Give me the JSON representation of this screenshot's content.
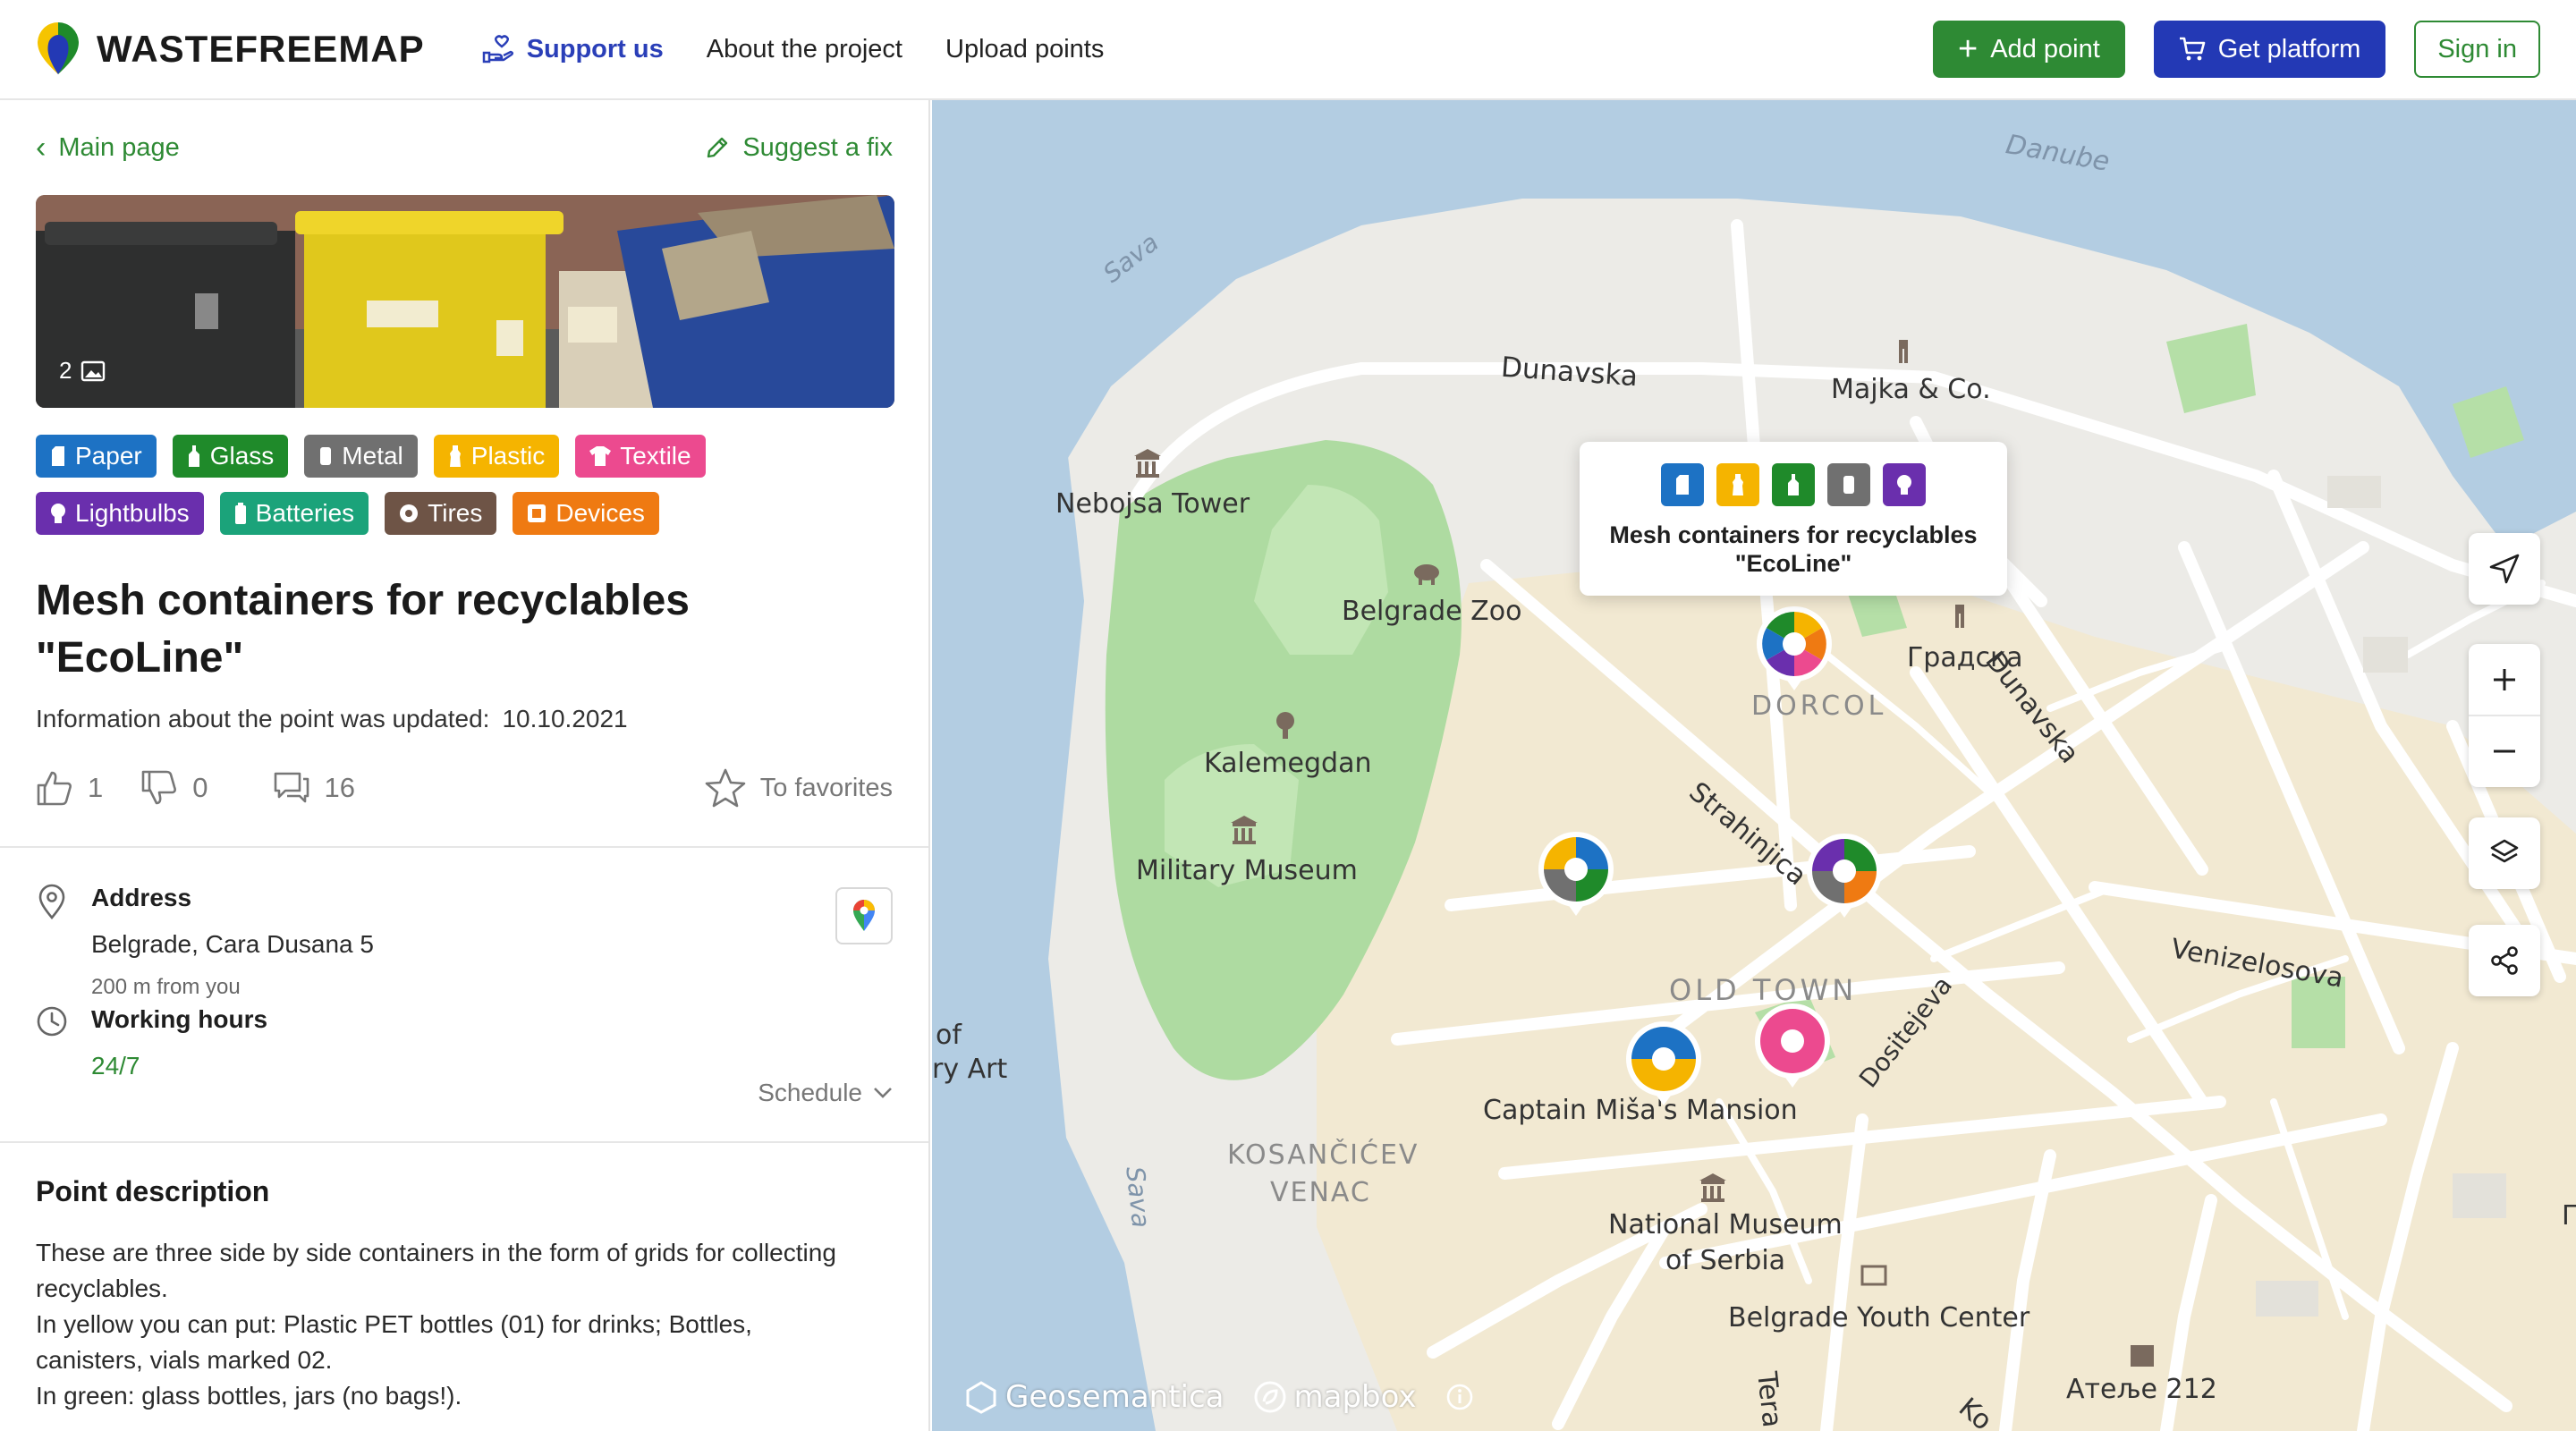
{
  "header": {
    "logo_text": "WASTEFREEMAP",
    "nav": {
      "support": "Support us",
      "about": "About the project",
      "upload": "Upload points"
    },
    "add_point": "Add point",
    "get_platform": "Get platform",
    "sign_in": "Sign in"
  },
  "sidebar": {
    "back_label": "Main page",
    "suggest_label": "Suggest a fix",
    "photo_count": "2",
    "tags": [
      {
        "label": "Paper",
        "color": "#1d72c4"
      },
      {
        "label": "Glass",
        "color": "#1f8a2a"
      },
      {
        "label": "Metal",
        "color": "#707070"
      },
      {
        "label": "Plastic",
        "color": "#f5b400"
      },
      {
        "label": "Textile",
        "color": "#ec4a8f"
      },
      {
        "label": "Lightbulbs",
        "color": "#6a2fad"
      },
      {
        "label": "Batteries",
        "color": "#1ba37a"
      },
      {
        "label": "Tires",
        "color": "#6e5446"
      },
      {
        "label": "Devices",
        "color": "#ef7a12"
      }
    ],
    "title": "Mesh containers for recyclables \"EcoLine\"",
    "updated_label": "Information about the point was updated:",
    "updated_date": "10.10.2021",
    "likes": "1",
    "dislikes": "0",
    "comments": "16",
    "favorites_label": "To favorites",
    "address_label": "Address",
    "address_value": "Belgrade, Cara Dusana 5",
    "address_distance": "200 m from you",
    "hours_label": "Working hours",
    "hours_value": "24/7",
    "schedule_label": "Schedule",
    "description_title": "Point description",
    "description_lines": [
      "These are three side by side containers in the form of grids for collecting recyclables.",
      "In yellow you can put: Plastic PET bottles (01) for drinks; Bottles, canisters, vials marked 02.",
      "In green: glass bottles, jars (no bags!)."
    ]
  },
  "map": {
    "popup_title": "Mesh containers for recyclables \"EcoLine\"",
    "popup_icon_colors": [
      "#1d72c4",
      "#f5b400",
      "#1f8a2a",
      "#707070",
      "#6a2fad"
    ],
    "labels": {
      "danube": "Danube",
      "sava_top": "Sava",
      "sava_bottom": "Sava",
      "dunavska_top": "Dunavska",
      "dunavska_right": "Dunavska",
      "majka": "Majka & Co.",
      "nebojsa": "Nebojsa Tower",
      "zoo": "Belgrade Zoo",
      "gradska": "Градска",
      "dorcol": "DORCOL",
      "kalemegdan": "Kalemegdan",
      "military": "Military Museum",
      "strahinjica": "Strahinjica",
      "venizelosova": "Venizelosova",
      "old_town": "OLD TOWN",
      "dositejeva": "Dositejeva",
      "of": "of",
      "ry_art": "ry Art",
      "captain": "Captain Miša's Mansion",
      "kosancicev_1": "KOSANČIĆEV",
      "kosancicev_2": "VENAC",
      "national_1": "National Museum",
      "national_2": "of Serbia",
      "youth": "Belgrade Youth Center",
      "atelje": "Атеље 212",
      "tera": "Tera",
      "ko": "Ko",
      "edge_p": "П"
    },
    "attribution": {
      "geosemantica": "Geosemantica",
      "mapbox": "mapbox"
    }
  },
  "colors": {
    "brand_green": "#2e8a34",
    "brand_blue": "#2339b5",
    "park": "#aedba1",
    "water": "#aec9e0",
    "oldtown": "#f3e8cf"
  }
}
